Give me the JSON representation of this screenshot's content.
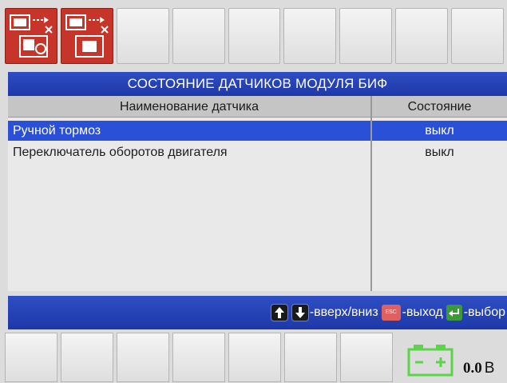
{
  "title": "СОСТОЯНИЕ ДАТЧИКОВ МОДУЛЯ БИФ",
  "table": {
    "headers": {
      "name": "Наименование датчика",
      "state": "Состояние"
    },
    "rows": [
      {
        "name": "Ручной тормоз",
        "state": "выкл",
        "selected": true
      },
      {
        "name": "Переключатель оборотов двигателя",
        "state": "выкл",
        "selected": false
      }
    ]
  },
  "hints": {
    "updown": "-вверх/вниз",
    "esc_key": "ESC",
    "exit": "-выход",
    "select": "-выбор"
  },
  "status": {
    "voltage_value": "0.0",
    "voltage_unit": "В",
    "battery_icon": "battery-icon"
  },
  "icons": {
    "top_key_1": "module-camera-icon",
    "top_key_2": "module-device-icon"
  },
  "colors": {
    "accent_blue": "#1d38a8",
    "selection_blue": "#2b50d8",
    "icon_red": "#c7352a",
    "battery_green": "#5cd34a"
  }
}
